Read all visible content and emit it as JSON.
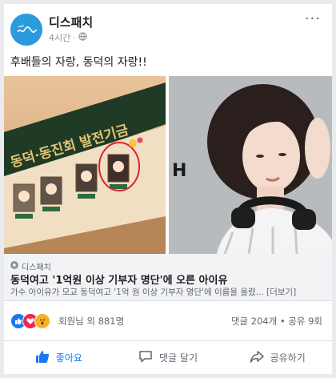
{
  "header": {
    "page_name": "디스패치",
    "time": "4시간",
    "separator": "·",
    "more": "···"
  },
  "post": {
    "text": "후배들의 자랑, 동덕의 자랑!!"
  },
  "photo_left": {
    "banner_text": "동덕·동진회 발전기금"
  },
  "photo_right": {
    "backdrop_text": "H"
  },
  "link": {
    "source": "디스패치",
    "headline": "동덕여고 '1억원 이상 기부자 명단'에 오른 아이유",
    "description": "가수 아이유가 모교 동덕여고 '1억 원 이상 기부자 명단'에 이름을 올렸... [더보기]"
  },
  "reactions": {
    "summary": "회원님 외 881명",
    "stats": "댓글 204개 • 공유 9회",
    "icons": [
      "like-icon",
      "love-icon",
      "wow-icon"
    ]
  },
  "actions": {
    "like": "좋아요",
    "comment": "댓글 달기",
    "share": "공유하기"
  },
  "colors": {
    "facebook_blue": "#1877f2",
    "love_red": "#f0284a",
    "wow_yellow": "#f7b125",
    "avatar_blue": "#2b9bde"
  }
}
